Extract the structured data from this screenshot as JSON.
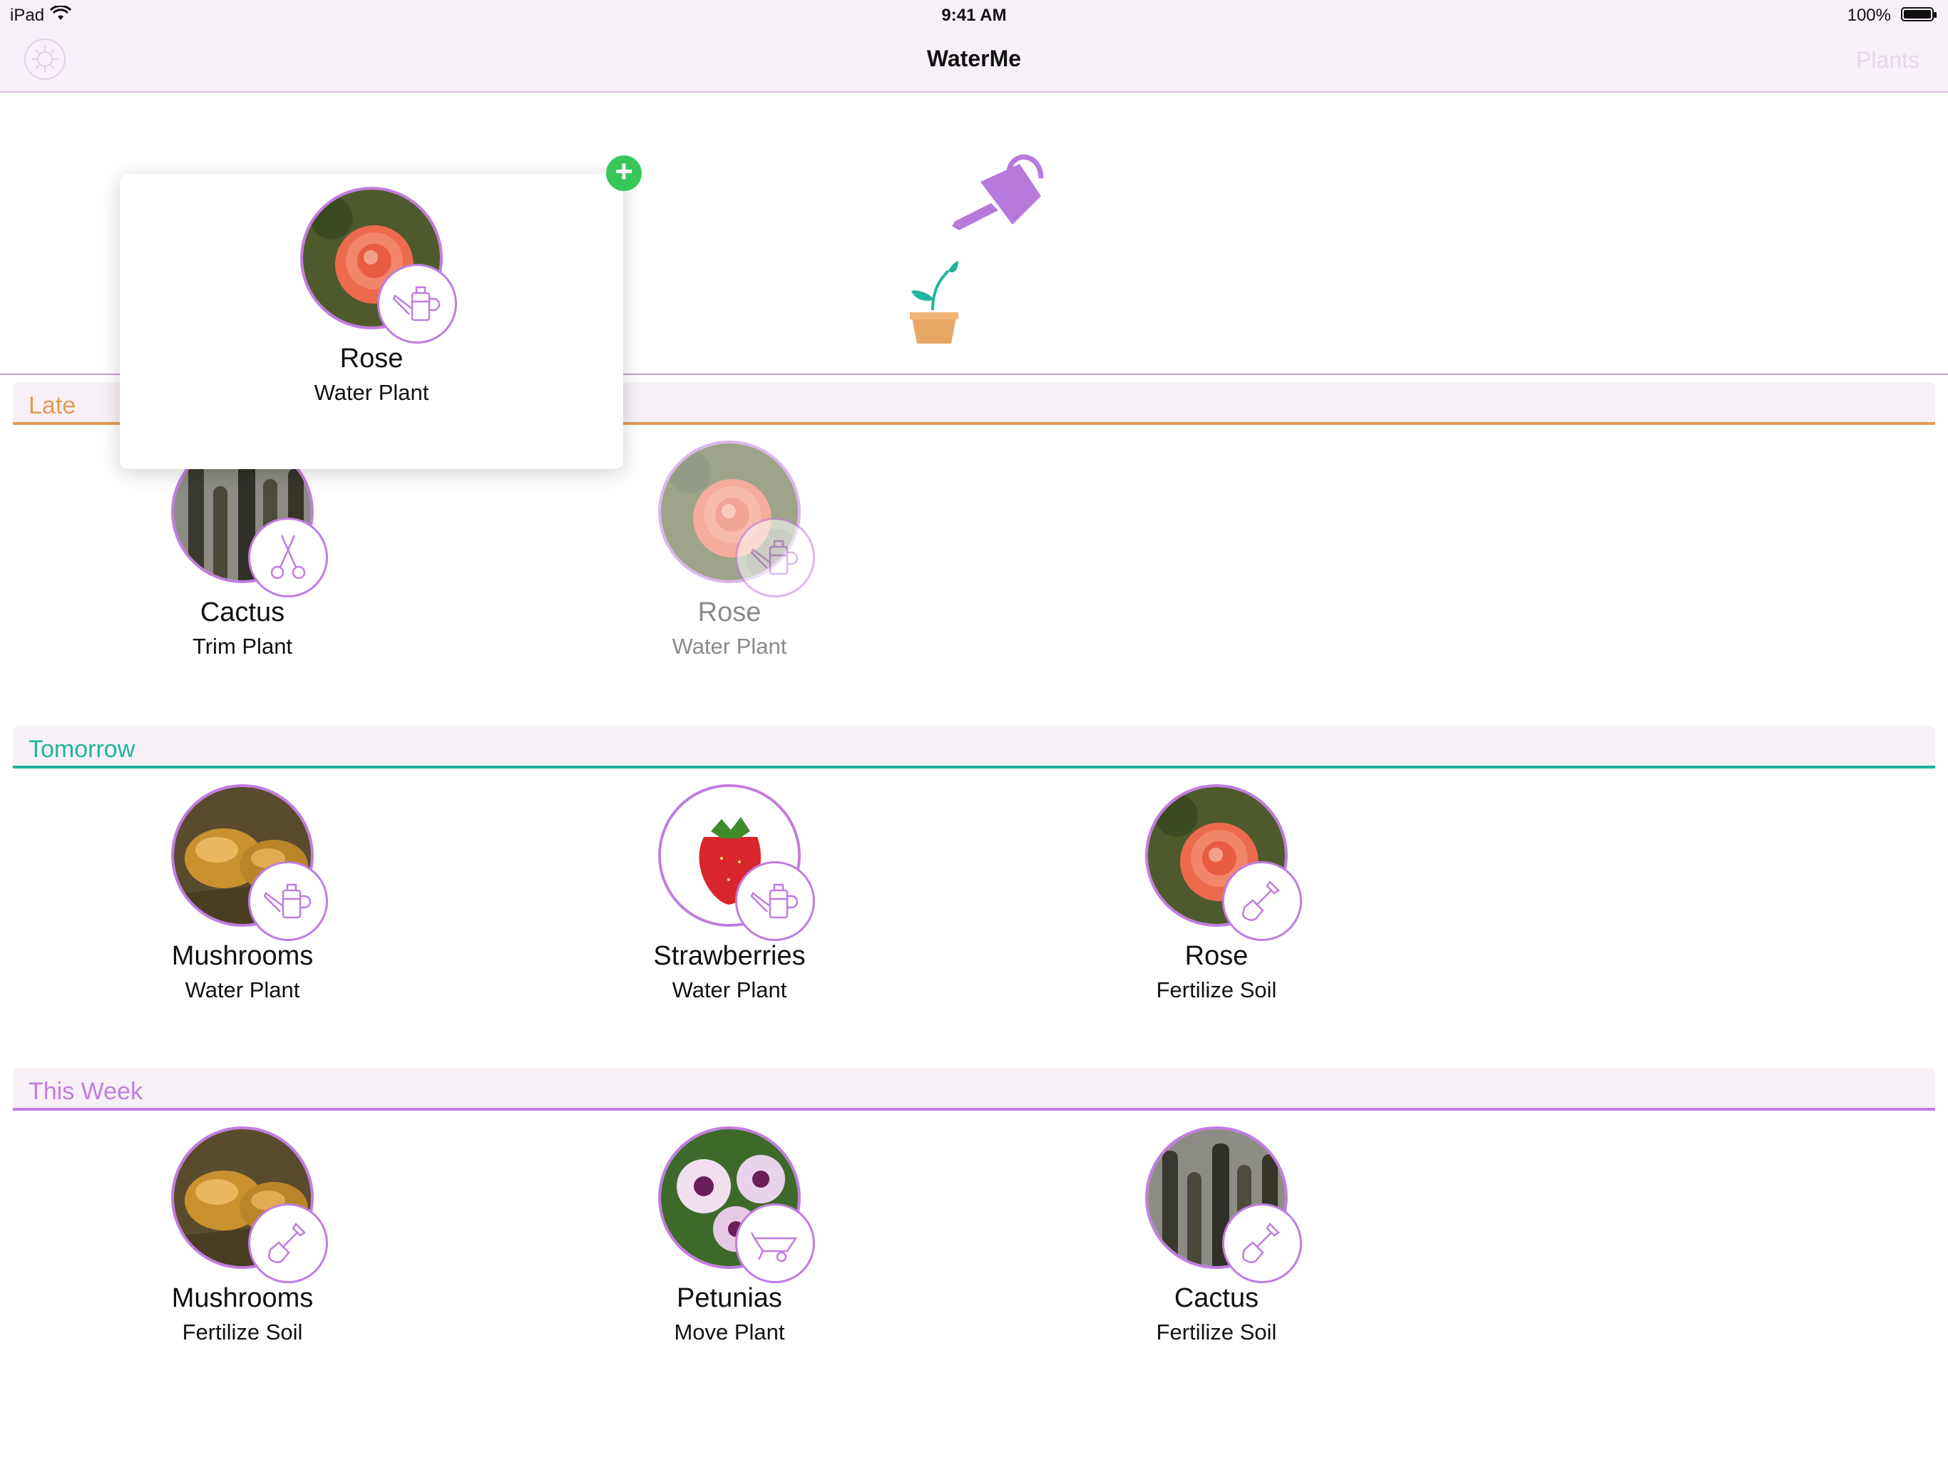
{
  "status_bar": {
    "device": "iPad",
    "time": "9:41 AM",
    "battery": "100%",
    "battery_level": 1.0
  },
  "nav": {
    "title": "WaterMe",
    "right_button": "Plants"
  },
  "drag_preview": {
    "name": "Rose",
    "task": "Water Plant"
  },
  "sections": [
    {
      "label": "Late",
      "color": "#e29a52",
      "items": [
        {
          "name": "Cactus",
          "task": "Trim Plant",
          "photo": "cactus",
          "icon": "scissors-icon"
        },
        {
          "name": "Rose",
          "task": "Water Plant",
          "photo": "rose",
          "icon": "watering-can-icon",
          "faded": true
        }
      ]
    },
    {
      "label": "Tomorrow",
      "color": "#1fb59a",
      "items": [
        {
          "name": "Mushrooms",
          "task": "Water Plant",
          "photo": "mushrooms",
          "icon": "watering-can-icon"
        },
        {
          "name": "Strawberries",
          "task": "Water Plant",
          "photo": "strawberry",
          "icon": "watering-can-icon"
        },
        {
          "name": "Rose",
          "task": "Fertilize Soil",
          "photo": "rose",
          "icon": "shovel-icon"
        }
      ]
    },
    {
      "label": "This Week",
      "color": "#c17de0",
      "items": [
        {
          "name": "Mushrooms",
          "task": "Fertilize Soil",
          "photo": "mushrooms",
          "icon": "shovel-icon"
        },
        {
          "name": "Petunias",
          "task": "Move Plant",
          "photo": "petunias",
          "icon": "wheelbarrow-icon"
        },
        {
          "name": "Cactus",
          "task": "Fertilize Soil",
          "photo": "cactus",
          "icon": "shovel-icon"
        }
      ]
    }
  ]
}
